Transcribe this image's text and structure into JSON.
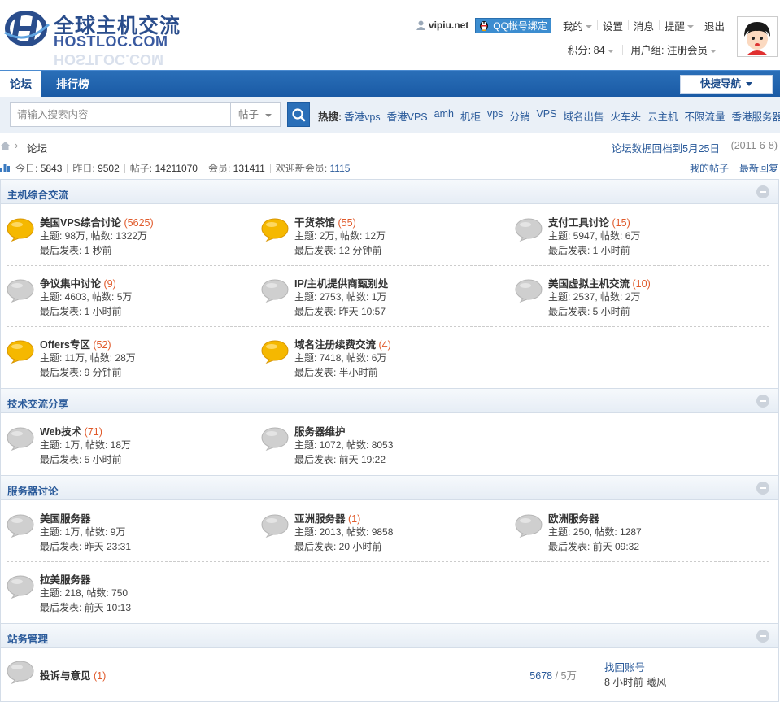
{
  "header": {
    "logo_cn": "全球主机交流",
    "logo_en": "HOSTLOC.COM",
    "username": "vipiu.net",
    "qq_bind": "QQ帐号绑定",
    "menu": [
      "我的",
      "设置",
      "消息",
      "提醒",
      "退出"
    ],
    "points_label": "积分: 84",
    "usergroup_label": "用户组: 注册会员"
  },
  "nav": {
    "tabs": [
      "论坛",
      "排行榜"
    ],
    "quick_nav": "快捷导航"
  },
  "search": {
    "placeholder": "请输入搜索内容",
    "type": "帖子",
    "hot_label": "热搜:",
    "hot": [
      "香港vps",
      "香港VPS",
      "amh",
      "机柜",
      "vps",
      "分销",
      "VPS",
      "域名出售",
      "火车头",
      "云主机",
      "不限流量",
      "香港服务器"
    ]
  },
  "breadcrumb": {
    "current": "论坛",
    "notice": "论坛数据回档到5月25日",
    "notice_date": "(2011-6-8)"
  },
  "stats": {
    "today_label": "今日:",
    "today": "5843",
    "yesterday_label": "昨日:",
    "yesterday": "9502",
    "posts_label": "帖子:",
    "posts": "14211070",
    "members_label": "会员:",
    "members": "131411",
    "welcome_label": "欢迎新会员:",
    "welcome": "1115",
    "my_posts": "我的帖子",
    "latest_replies": "最新回复"
  },
  "sections": [
    {
      "title": "主机综合交流",
      "forums": [
        {
          "name": "美国VPS综合讨论",
          "count": "(5625)",
          "stats": "主题: 98万, 帖数: 1322万",
          "last": "最后发表: 1 秒前",
          "icon": "new-posts-icon"
        },
        {
          "name": "干货茶馆",
          "count": "(55)",
          "stats": "主题: 2万, 帖数: 12万",
          "last": "最后发表: 12 分钟前",
          "icon": "new-posts-icon"
        },
        {
          "name": "支付工具讨论",
          "count": "(15)",
          "stats": "主题: 5947, 帖数: 6万",
          "last": "最后发表: 1 小时前",
          "icon": "no-new-posts-icon"
        },
        {
          "name": "争议集中讨论",
          "count": "(9)",
          "stats": "主题: 4603, 帖数: 5万",
          "last": "最后发表: 1 小时前",
          "icon": "no-new-posts-icon"
        },
        {
          "name": "IP/主机提供商甄别处",
          "count": "",
          "stats": "主题: 2753, 帖数: 1万",
          "last": "最后发表: 昨天 10:57",
          "icon": "no-new-posts-icon"
        },
        {
          "name": "美国虚拟主机交流",
          "count": "(10)",
          "stats": "主题: 2537, 帖数: 2万",
          "last": "最后发表: 5 小时前",
          "icon": "no-new-posts-icon"
        },
        {
          "name": "Offers专区",
          "count": "(52)",
          "stats": "主题: 11万, 帖数: 28万",
          "last": "最后发表: 9 分钟前",
          "icon": "new-posts-icon"
        },
        {
          "name": "域名注册续费交流",
          "count": "(4)",
          "stats": "主题: 7418, 帖数: 6万",
          "last": "最后发表: 半小时前",
          "icon": "new-posts-icon"
        }
      ]
    },
    {
      "title": "技术交流分享",
      "forums": [
        {
          "name": "Web技术",
          "count": "(71)",
          "stats": "主题: 1万, 帖数: 18万",
          "last": "最后发表: 5 小时前",
          "icon": "no-new-posts-icon"
        },
        {
          "name": "服务器维护",
          "count": "",
          "stats": "主题: 1072, 帖数: 8053",
          "last": "最后发表: 前天 19:22",
          "icon": "no-new-posts-icon"
        }
      ]
    },
    {
      "title": "服务器讨论",
      "forums": [
        {
          "name": "美国服务器",
          "count": "",
          "stats": "主题: 1万, 帖数: 9万",
          "last": "最后发表: 昨天 23:31",
          "icon": "no-new-posts-icon"
        },
        {
          "name": "亚洲服务器",
          "count": "(1)",
          "stats": "主题: 2013, 帖数: 9858",
          "last": "最后发表: 20 小时前",
          "icon": "no-new-posts-icon"
        },
        {
          "name": "欧洲服务器",
          "count": "",
          "stats": "主题: 250, 帖数: 1287",
          "last": "最后发表: 前天 09:32",
          "icon": "no-new-posts-icon"
        },
        {
          "name": "拉美服务器",
          "count": "",
          "stats": "主题: 218, 帖数: 750",
          "last": "最后发表: 前天 10:13",
          "icon": "no-new-posts-icon"
        }
      ]
    },
    {
      "title": "站务管理",
      "forums": [
        {
          "name": "投诉与意见",
          "count": "(1)",
          "threads": "5678",
          "posts": "/ 5万",
          "last_title": "找回账号",
          "last_info": "8 小时前 曦风",
          "icon": "no-new-posts-icon"
        }
      ]
    }
  ]
}
